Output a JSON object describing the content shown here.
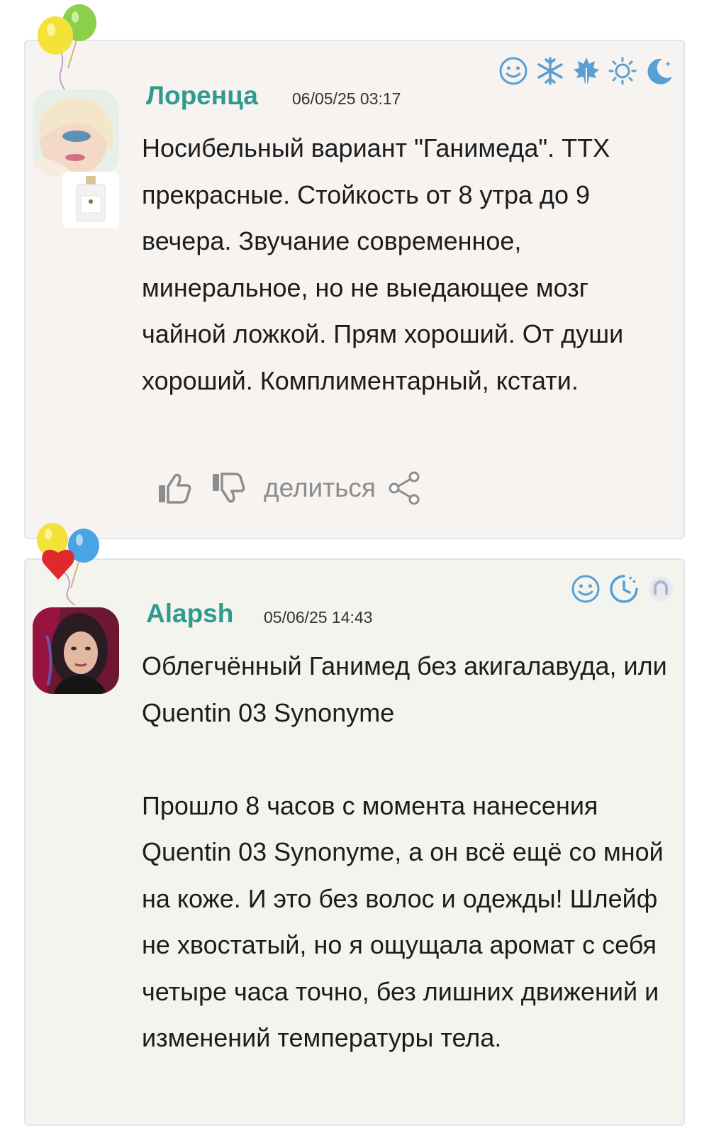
{
  "comments": [
    {
      "author": "Лоренца",
      "date": "06/05/25 03:17",
      "text": "Носибельный вариант \"Ганимеда\". ТТХ прекрасные. Стойкость от 8 утра до 9 вечера. Звучание современное, минеральное, но не выедающее мозг чайной ложкой. Прям хороший. От души хороший. Комплиментарный, кстати.",
      "status_icons": [
        "smiley-icon",
        "snowflake-icon",
        "maple-leaf-icon",
        "sun-icon",
        "moon-icon"
      ]
    },
    {
      "author": "Alapsh",
      "date": "05/06/25 14:43",
      "text": "Облегчённый Ганимед без акигалавуда, или Quentin 03 Synonyme\n\nПрошло 8 часов с момента нанесения Quentin 03 Synonyme, а он всё ещё со мной на коже. И это без волос и одежды! Шлейф не хвостатый, но я ощущала аромат с себя четыре часа точно, без лишних движений и изменений температуры тела.",
      "status_icons": [
        "smiley-icon",
        "clock-icon",
        "magnet-icon"
      ]
    }
  ],
  "actions": {
    "share_label": "делиться"
  },
  "colors": {
    "author": "#2f9a8e",
    "icon_blue": "#5a9fd1",
    "card_bg_1": "#f6f3f1",
    "card_bg_2": "#f4f4ef",
    "card_border": "#dfe6ec",
    "action_gray": "#8d8d8d"
  }
}
